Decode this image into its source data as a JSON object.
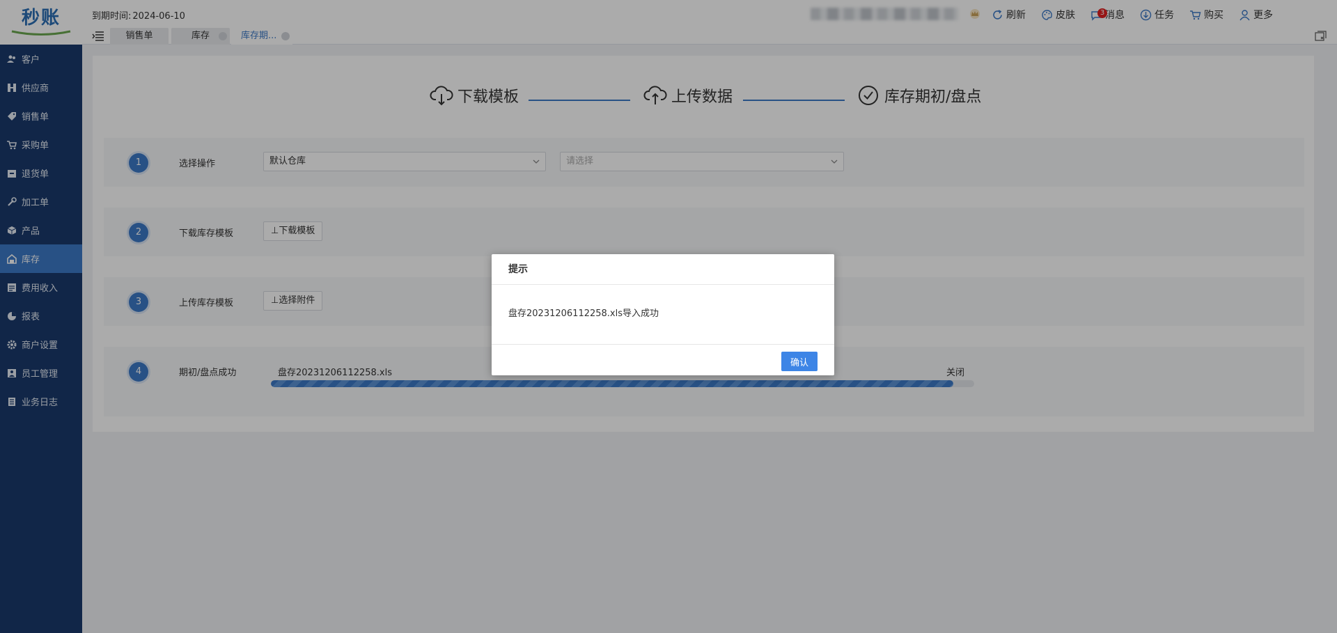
{
  "app": {
    "logo_text": "秒账"
  },
  "header": {
    "expire_label": "到期时间:",
    "expire_date": "2024-06-10",
    "tools": [
      {
        "name": "refresh",
        "label": "刷新"
      },
      {
        "name": "skin",
        "label": "皮肤"
      },
      {
        "name": "message",
        "label": "消息",
        "badge": "3"
      },
      {
        "name": "task",
        "label": "任务"
      },
      {
        "name": "buy",
        "label": "购买"
      },
      {
        "name": "more",
        "label": "更多"
      }
    ]
  },
  "tabs": [
    {
      "label": "销售单"
    },
    {
      "label": "库存"
    },
    {
      "label": "库存期..."
    }
  ],
  "sidebar": {
    "items": [
      {
        "label": "客户"
      },
      {
        "label": "供应商"
      },
      {
        "label": "销售单"
      },
      {
        "label": "采购单"
      },
      {
        "label": "退货单"
      },
      {
        "label": "加工单"
      },
      {
        "label": "产品"
      },
      {
        "label": "库存",
        "active": true
      },
      {
        "label": "费用收入"
      },
      {
        "label": "报表"
      },
      {
        "label": "商户设置"
      },
      {
        "label": "员工管理"
      },
      {
        "label": "业务日志"
      }
    ]
  },
  "steps": [
    {
      "label": "下载模板"
    },
    {
      "label": "上传数据"
    },
    {
      "label": "库存期初/盘点"
    }
  ],
  "rows": {
    "r1": {
      "num": "1",
      "label": "选择操作",
      "warehouse_value": "默认仓库",
      "second_placeholder": "请选择"
    },
    "r2": {
      "num": "2",
      "label": "下载库存模板",
      "button": "⊥下载模板"
    },
    "r3": {
      "num": "3",
      "label": "上传库存模板",
      "button": "⊥选择附件"
    },
    "r4": {
      "num": "4",
      "label": "期初/盘点成功",
      "file_name": "盘存20231206112258.xls",
      "close_label": "关闭",
      "progress_percent": 97
    }
  },
  "dialog": {
    "title": "提示",
    "message": "盘存20231206112258.xls导入成功",
    "confirm_label": "确认"
  },
  "colors": {
    "sidebar": "#1a3a6c",
    "accent": "#3d79c6",
    "confirm": "#3d85e6"
  }
}
